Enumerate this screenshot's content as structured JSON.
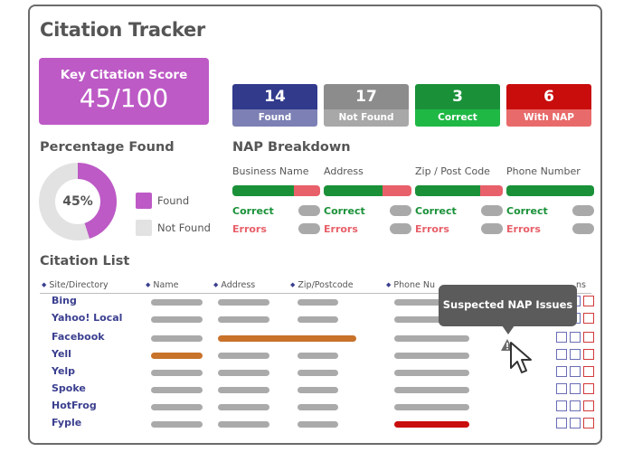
{
  "app": {
    "title": "Citation Tracker"
  },
  "score": {
    "label": "Key Citation Score",
    "value": "45/100",
    "color": "#bd5ac6"
  },
  "stats": [
    {
      "value": "14",
      "label": "Found",
      "top_color": "#323a8c",
      "bottom_color": "#7c80b4"
    },
    {
      "value": "17",
      "label": "Not Found",
      "top_color": "#8c8c8c",
      "bottom_color": "#a8a8a8"
    },
    {
      "value": "3",
      "label": "Correct",
      "top_color": "#1a9139",
      "bottom_color": "#1fb845"
    },
    {
      "value": "6",
      "label": "With NAP Errors",
      "top_color": "#c90c0c",
      "bottom_color": "#e86a6a"
    }
  ],
  "percentage": {
    "heading": "Percentage Found",
    "value_label": "45%",
    "found_fraction": 0.45,
    "found_color": "#bd5ac6",
    "not_found_color": "#e2e2e2",
    "legend": [
      {
        "label": "Found",
        "color": "#bd5ac6"
      },
      {
        "label": "Not Found",
        "color": "#e2e2e2"
      }
    ]
  },
  "nap": {
    "heading": "NAP Breakdown",
    "correct_label": "Correct",
    "errors_label": "Errors",
    "correct_color": "#1a9139",
    "error_color": "#e8606a",
    "columns": [
      {
        "label": "Business Name",
        "correct_fraction": 0.7
      },
      {
        "label": "Address",
        "correct_fraction": 0.67
      },
      {
        "label": "Zip / Post Code",
        "correct_fraction": 0.74
      },
      {
        "label": "Phone Number",
        "correct_fraction": 1.0
      }
    ]
  },
  "citation_list": {
    "heading": "Citation List",
    "columns": [
      "Site/Directory",
      "Name",
      "Address",
      "Zip/Postcode",
      "Phone Number",
      "Actions"
    ],
    "visible_headers": [
      "Site/Directory",
      "Name",
      "Address",
      "Zip/Postcode",
      "Phone Nu",
      "ns"
    ],
    "rows": [
      {
        "site": "Bing",
        "name": "ok",
        "address": "ok",
        "zip": "ok",
        "phone": "ok"
      },
      {
        "site": "Yahoo! Local",
        "name": "ok",
        "address": "ok",
        "zip": "ok",
        "phone": "ok"
      },
      {
        "site": "Facebook",
        "name": "ok",
        "address": "warning-merged",
        "zip": "merged",
        "phone": "ok"
      },
      {
        "site": "Yell",
        "name": "warning",
        "address": "ok",
        "zip": "ok",
        "phone": "ok"
      },
      {
        "site": "Yelp",
        "name": "ok",
        "address": "ok",
        "zip": "ok",
        "phone": "ok"
      },
      {
        "site": "Spoke",
        "name": "ok",
        "address": "ok",
        "zip": "ok",
        "phone": "ok"
      },
      {
        "site": "HotFrog",
        "name": "ok",
        "address": "ok",
        "zip": "ok",
        "phone": "ok"
      },
      {
        "site": "Fyple",
        "name": "ok",
        "address": "ok",
        "zip": "ok",
        "phone": "error"
      }
    ],
    "status_colors": {
      "ok": "#aaaaaa",
      "warning": "#c8722a",
      "error": "#c90c0c"
    }
  },
  "tooltip": {
    "text": "Suspected NAP Issues"
  }
}
